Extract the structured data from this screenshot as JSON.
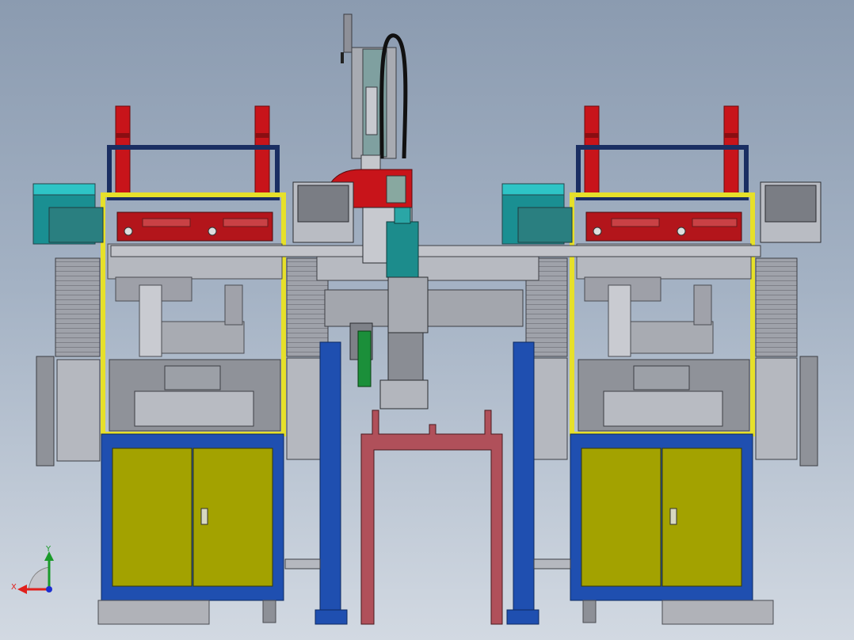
{
  "triad": {
    "x_label": "X",
    "y_label": "Y",
    "x_color": "#e0201c",
    "y_color": "#1a9a2a",
    "z_color": "#1c2fd0"
  },
  "colors": {
    "frame_yellow": "#e6e02a",
    "cabinet_olive": "#a3a200",
    "frame_blue": "#1f4fb0",
    "beacon_red": "#c8141a",
    "machine_gray": "#9ea0a8",
    "panel_teal": "#1aa8a8",
    "red_box": "#b3151b",
    "gantry_red": "#b0505a"
  }
}
